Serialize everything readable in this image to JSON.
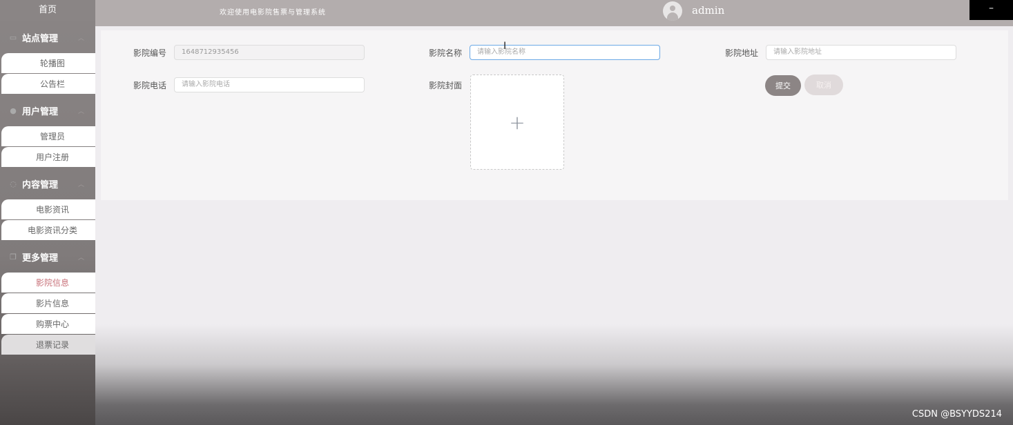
{
  "sidebar": {
    "home": "首页",
    "groups": [
      {
        "label": "站点管理",
        "icon": "monitor-icon",
        "items": [
          {
            "label": "轮播图"
          },
          {
            "label": "公告栏"
          }
        ]
      },
      {
        "label": "用户管理",
        "icon": "user-icon",
        "items": [
          {
            "label": "管理员"
          },
          {
            "label": "用户注册"
          }
        ]
      },
      {
        "label": "内容管理",
        "icon": "chat-icon",
        "items": [
          {
            "label": "电影资讯"
          },
          {
            "label": "电影资讯分类"
          }
        ]
      },
      {
        "label": "更多管理",
        "icon": "copy-icon",
        "items": [
          {
            "label": "影院信息",
            "active": true
          },
          {
            "label": "影片信息"
          },
          {
            "label": "购票中心"
          },
          {
            "label": "退票记录"
          }
        ]
      }
    ]
  },
  "topbar": {
    "welcome": "欢迎使用电影院售票与管理系统",
    "username": "admin",
    "minimize": "–"
  },
  "form": {
    "id_label": "影院编号",
    "id_value": "1648712935456",
    "name_label": "影院名称",
    "name_placeholder": "请输入影院名称",
    "address_label": "影院地址",
    "address_placeholder": "请输入影院地址",
    "phone_label": "影院电话",
    "phone_placeholder": "请输入影院电话",
    "cover_label": "影院封面",
    "upload_symbol": "+",
    "submit": "提交",
    "cancel": "取消"
  },
  "watermark": "CSDN @BSYYDS214",
  "colors": {
    "sidebar": "#8a8585",
    "topbar": "#b3adad",
    "active_item": "#c8727a",
    "submit": "#8c8585"
  }
}
